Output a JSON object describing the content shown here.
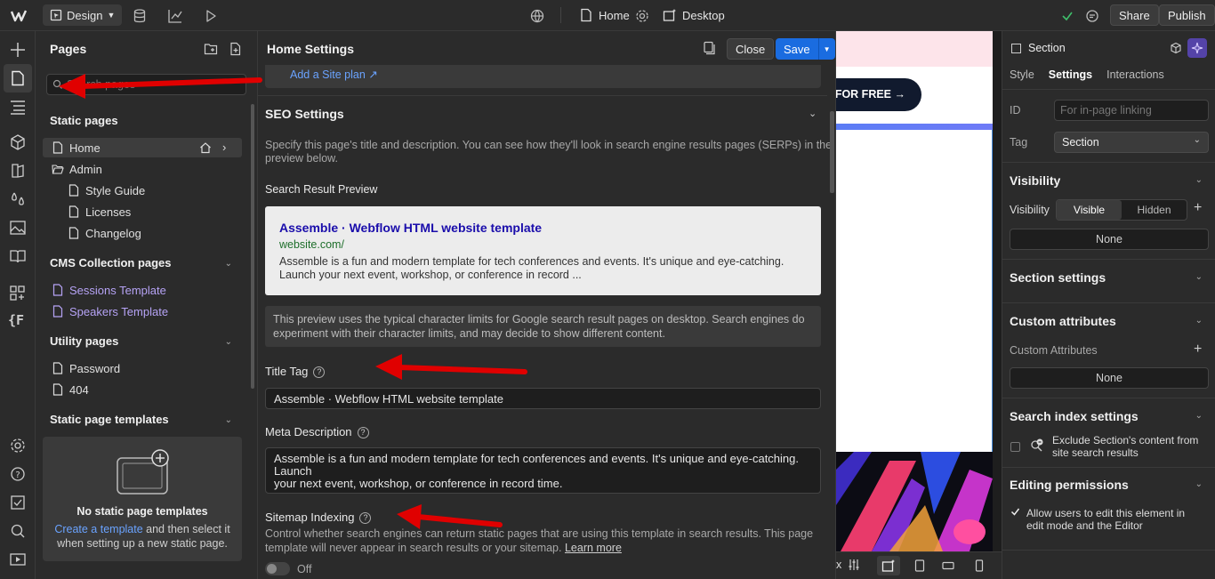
{
  "topbar": {
    "mode": "Design",
    "page": "Home",
    "breakpoint": "Desktop",
    "share": "Share",
    "publish": "Publish"
  },
  "pages": {
    "title": "Pages",
    "search_placeholder": "Search pages",
    "static_header": "Static pages",
    "static_items": [
      "Home",
      "Admin",
      "Style Guide",
      "Licenses",
      "Changelog"
    ],
    "cms_header": "CMS Collection pages",
    "cms_items": [
      "Sessions Template",
      "Speakers Template"
    ],
    "utility_header": "Utility pages",
    "utility_items": [
      "Password",
      "404"
    ],
    "templates_header": "Static page templates",
    "empty_title": "No static page templates",
    "empty_link": "Create a template",
    "empty_text_1": "and then select it",
    "empty_text_2": "when setting up a new static page."
  },
  "settings": {
    "title": "Home Settings",
    "close": "Close",
    "save": "Save",
    "site_plan_link": "Add a Site plan ↗",
    "seo_header": "SEO Settings",
    "seo_desc_1": "Specify this page's title and description. You can see how they'll look in search engine results pages (SERPs) in the",
    "seo_desc_2": "preview below.",
    "preview_label": "Search Result Preview",
    "preview_title": "Assemble · Webflow HTML website template",
    "preview_url": "website.com/",
    "preview_desc_1": "Assemble is a fun and modern template for tech conferences and events. It's unique and eye-catching.",
    "preview_desc_2": "Launch your next event, workshop, or conference in record ...",
    "note_1": "This preview uses the typical character limits for Google search result pages on desktop. Search engines do",
    "note_2": "experiment with their character limits, and may decide to show different content.",
    "title_tag_label": "Title Tag",
    "title_tag_value": "Assemble · Webflow HTML website template",
    "meta_label": "Meta Description",
    "meta_value_1": "Assemble is a fun and modern template for tech conferences and events. It's unique and eye-catching. Launch",
    "meta_value_2": "your next event, workshop, or conference in record time.",
    "sitemap_label": "Sitemap Indexing",
    "sitemap_desc_1": "Control whether search engines can return static pages that are using this template in search results. This page",
    "sitemap_desc_2": "template will never appear in search results or your sitemap.",
    "learn_more": "Learn more",
    "toggle_state": "Off"
  },
  "canvas": {
    "cta": "FOR FREE →"
  },
  "right": {
    "element": "Section",
    "tabs": [
      "Style",
      "Settings",
      "Interactions"
    ],
    "id_label": "ID",
    "id_placeholder": "For in-page linking",
    "tag_label": "Tag",
    "tag_value": "Section",
    "visibility_header": "Visibility",
    "visibility_label": "Visibility",
    "visible": "Visible",
    "hidden": "Hidden",
    "none": "None",
    "section_settings": "Section settings",
    "custom_attr_header": "Custom attributes",
    "custom_attr_label": "Custom Attributes",
    "search_index_header": "Search index settings",
    "exclude_1": "Exclude Section's content from",
    "exclude_2": "site search results",
    "editing_header": "Editing permissions",
    "allow_1": "Allow users to edit this element in",
    "allow_2": "edit mode and the Editor"
  },
  "colors": {
    "accent": "#1a6ce0",
    "purple_link": "#b6a3f5",
    "arrow": "#e00000"
  }
}
